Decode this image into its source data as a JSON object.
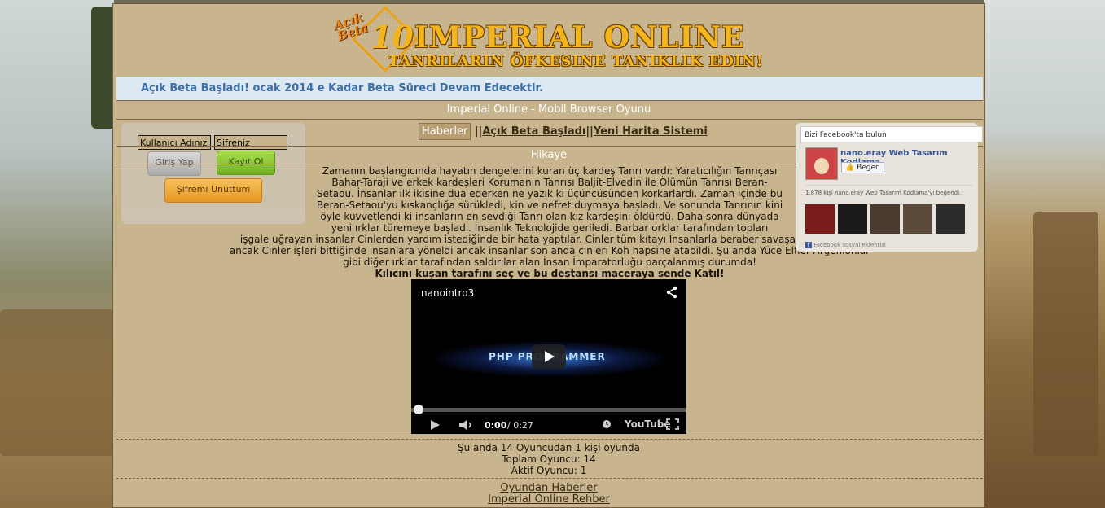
{
  "header": {
    "logo_badge": "Açık Beta",
    "logo_number": "10",
    "logo_title": "Imperial Online",
    "logo_subtitle": "Tanrıların Öfkesine Tanıklık Edin!"
  },
  "announcement": "Açık Beta Başladı! ocak 2014 e Kadar Beta Süreci Devam Edecektir.",
  "page_title": "Imperial Online - Mobil Browser Oyunu",
  "tabs": [
    {
      "label": "Haberler",
      "active": true
    },
    {
      "label": "Açık Beta Başladı",
      "active": false
    },
    {
      "label": "Yeni Harita Sistemi",
      "active": false
    }
  ],
  "tab_separator": "||",
  "login": {
    "username_placeholder": "Kullanıcı Adınız",
    "password_placeholder": "Şifreniz",
    "login_button": "Giriş Yap",
    "register_button": "Kayıt Ol",
    "forgot_button": "Şifremi Unuttum"
  },
  "story": {
    "heading": "Hikaye",
    "lines": [
      "Zamanın başlangıcında hayatın dengelerini kuran üç kardeş Tanrı vardı: Yaratıcılığın Tanrıçası",
      "Bahar-Taraji ve erkek kardeşleri Korumanın Tanrısı Baljit-Elvedin ile Ölümün Tanrısı Beran-",
      "Setaou. İnsanlar ilk ikisine dua ederken ne yazık ki üçüncüsünden korkarlardı. Zaman içinde bu",
      "Beran-Setaou'yu kıskançlığa sürükledi, kin ve nefret duymaya başladı. Ve sonunda Tanrının kini",
      "öyle kuvvetlendi ki insanların en sevdiği Tanrı olan kız kardeşini öldürdü. Daha sonra dünyada",
      "yeni ırklar türemeye başladı. İnsanlık Teknolojide geriledi. Barbar orklar tarafından topları",
      "işgale uğrayan insanlar Cinlerden yardım istediğinde bir hata yaptılar. Cinler tüm kıtayı İnsanlarla beraber savaşarak temizledi",
      "ancak Cinler işleri bittiğinde insanlara yöneldi ancak insanlar son anda cinleri Koh hapsine atabildi. Şu anda Yüce Elfler Argenionlar",
      "gibi diğer ırklar tarafından saldırılar alan İnsan İmparatorluğu parçalanmış durumda!"
    ],
    "cta": "Kılıcını kuşan tarafını seç ve bu destansı maceraya sende Katıl!"
  },
  "video": {
    "title": "nanointro3",
    "overlay_text": "PHP PROGRAMMER",
    "time_current": "0:00",
    "time_total": "/ 0:27",
    "brand": "YouTube",
    "progress": 0
  },
  "facebook": {
    "header": "Bizi Facebook'ta bulun",
    "page_name": "nano.eray Web Tasarım Kodlama",
    "like_button": "Beğen",
    "like_count_text": "1.878 kişi nano.eray Web Tasarım Kodlama'yı beğendi.",
    "footer": "Facebook sosyal eklentisi",
    "thumb_colors": [
      "#7a1c1c",
      "#1a1a1a",
      "#4a3a30",
      "#5b4a3a",
      "#2b2b2b"
    ]
  },
  "stats": {
    "online_line": "Şu anda 14 Oyuncudan 1 kişi oyunda",
    "total_line": "Toplam Oyuncu: 14",
    "active_line": "Aktif Oyuncu: 1"
  },
  "footer_links": [
    "Oyundan Haberler",
    "Imperial Online Rehber"
  ],
  "colors": {
    "parchment": "#c8b48c",
    "gold": "#f2b51e",
    "announcement_text": "#3b6fa8",
    "announcement_bg": "#dde9f2"
  }
}
